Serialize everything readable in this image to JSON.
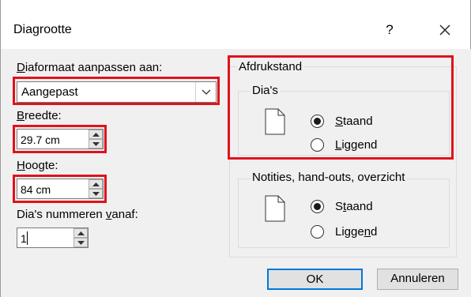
{
  "dialog": {
    "title": "Diagrootte",
    "help_label": "?"
  },
  "size_section": {
    "label_prefix": "D",
    "label_rest": "iaformaat aanpassen aan:",
    "select_value": "Aangepast",
    "width_label_prefix": "B",
    "width_label_rest": "reedte:",
    "width_value": "29.7 cm",
    "height_label_prefix": "H",
    "height_label_rest": "oogte:",
    "height_value": "84 cm",
    "numbering_label_a": "Dia's nummeren ",
    "numbering_label_b": "v",
    "numbering_label_c": "anaf:",
    "numbering_value": "1"
  },
  "orientation": {
    "title": "Afdrukstand",
    "slides": {
      "title": "Dia's",
      "portrait_prefix": "S",
      "portrait_rest": "taand",
      "landscape_prefix": "L",
      "landscape_rest": "iggend",
      "selected": "portrait"
    },
    "notes": {
      "title": "Notities, hand-outs, overzicht",
      "portrait_a": "S",
      "portrait_b": "t",
      "portrait_c": "aand",
      "landscape_a": "Ligge",
      "landscape_b": "n",
      "landscape_c": "d",
      "selected": "portrait"
    }
  },
  "buttons": {
    "ok": "OK",
    "cancel": "Annuleren"
  },
  "colors": {
    "highlight": "#e0121b",
    "primary_border": "#0078d7",
    "dialog_bg": "#f0f0f0"
  }
}
